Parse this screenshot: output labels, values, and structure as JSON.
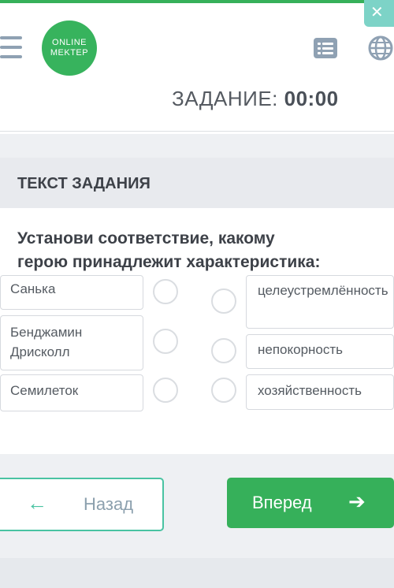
{
  "header": {
    "logo_line1": "ONLINE",
    "logo_line2": "MEKTEP",
    "timer_label": "ЗАДАНИЕ:",
    "timer_value": "00:00",
    "accent_color": "#36b05a"
  },
  "icons": {
    "menu": "hamburger-icon",
    "list": "list-icon",
    "language": "globe-icon",
    "close": "close-icon"
  },
  "task": {
    "section_title": "ТЕКСТ ЗАДАНИЯ",
    "question_line1": "Установи соответствие, какому",
    "question_line2": "герою принадлежит характеристика:",
    "left_items": [
      "Санька",
      "Бенджамин Дрисколл",
      "Семилеток"
    ],
    "right_items": [
      "целеустремлённость",
      "непокорность",
      "хозяйственность"
    ]
  },
  "navigation": {
    "back_label": "Назад",
    "next_label": "Вперед"
  }
}
